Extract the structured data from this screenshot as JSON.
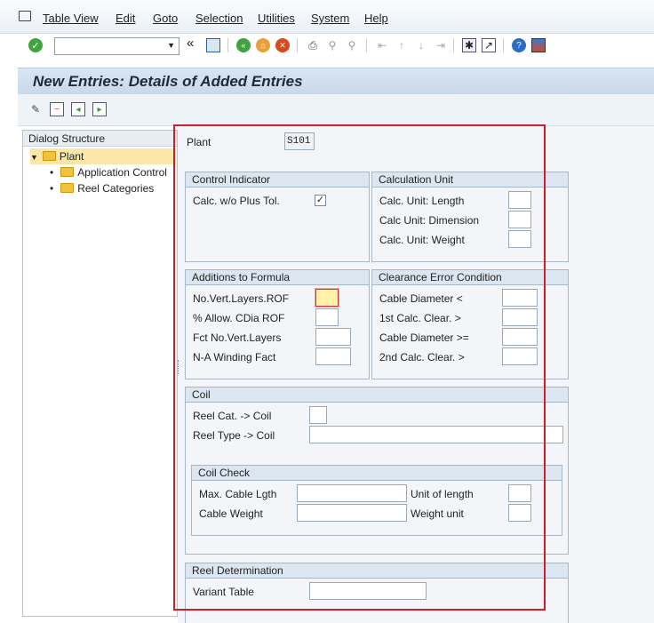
{
  "menu": [
    "Table View",
    "Edit",
    "Goto",
    "Selection",
    "Utilities",
    "System",
    "Help"
  ],
  "toolbar": {
    "command_field_value": "",
    "back_label": "«"
  },
  "page": {
    "title": "New Entries: Details of Added Entries"
  },
  "dialog": {
    "header": "Dialog Structure",
    "root": "Plant",
    "children": [
      "Application Control",
      "Reel Categories"
    ]
  },
  "plant": {
    "label": "Plant",
    "value": "S101"
  },
  "control_indicator": {
    "header": "Control Indicator",
    "calc_label": "Calc. w/o Plus Tol.",
    "checked": true
  },
  "calculation_unit": {
    "header": "Calculation Unit",
    "rows": [
      "Calc. Unit: Length",
      "Calc Unit: Dimension",
      "Calc. Unit: Weight"
    ]
  },
  "additions": {
    "header": "Additions to Formula",
    "rows": [
      "No.Vert.Layers.ROF",
      "% Allow. CDia ROF",
      "Fct No.Vert.Layers",
      "N-A Winding Fact"
    ]
  },
  "clearance": {
    "header": "Clearance Error Condition",
    "rows": [
      "Cable Diameter <",
      "1st Calc. Clear. >",
      "Cable Diameter >=",
      "2nd Calc. Clear. >"
    ]
  },
  "coil": {
    "header": "Coil",
    "reel_cat": "Reel Cat. -> Coil",
    "reel_type": "Reel Type -> Coil",
    "check": {
      "header": "Coil Check",
      "max_cable": "Max. Cable Lgth",
      "unit_length": "Unit of length",
      "cable_weight": "Cable Weight",
      "weight_unit": "Weight unit"
    }
  },
  "reel_determination": {
    "header": "Reel Determination",
    "variant_label": "Variant Table"
  },
  "colors": {
    "highlight_frame": "#cc1f2a",
    "active_field": "#fff2a8",
    "title_bg": "#d9e6f3"
  }
}
